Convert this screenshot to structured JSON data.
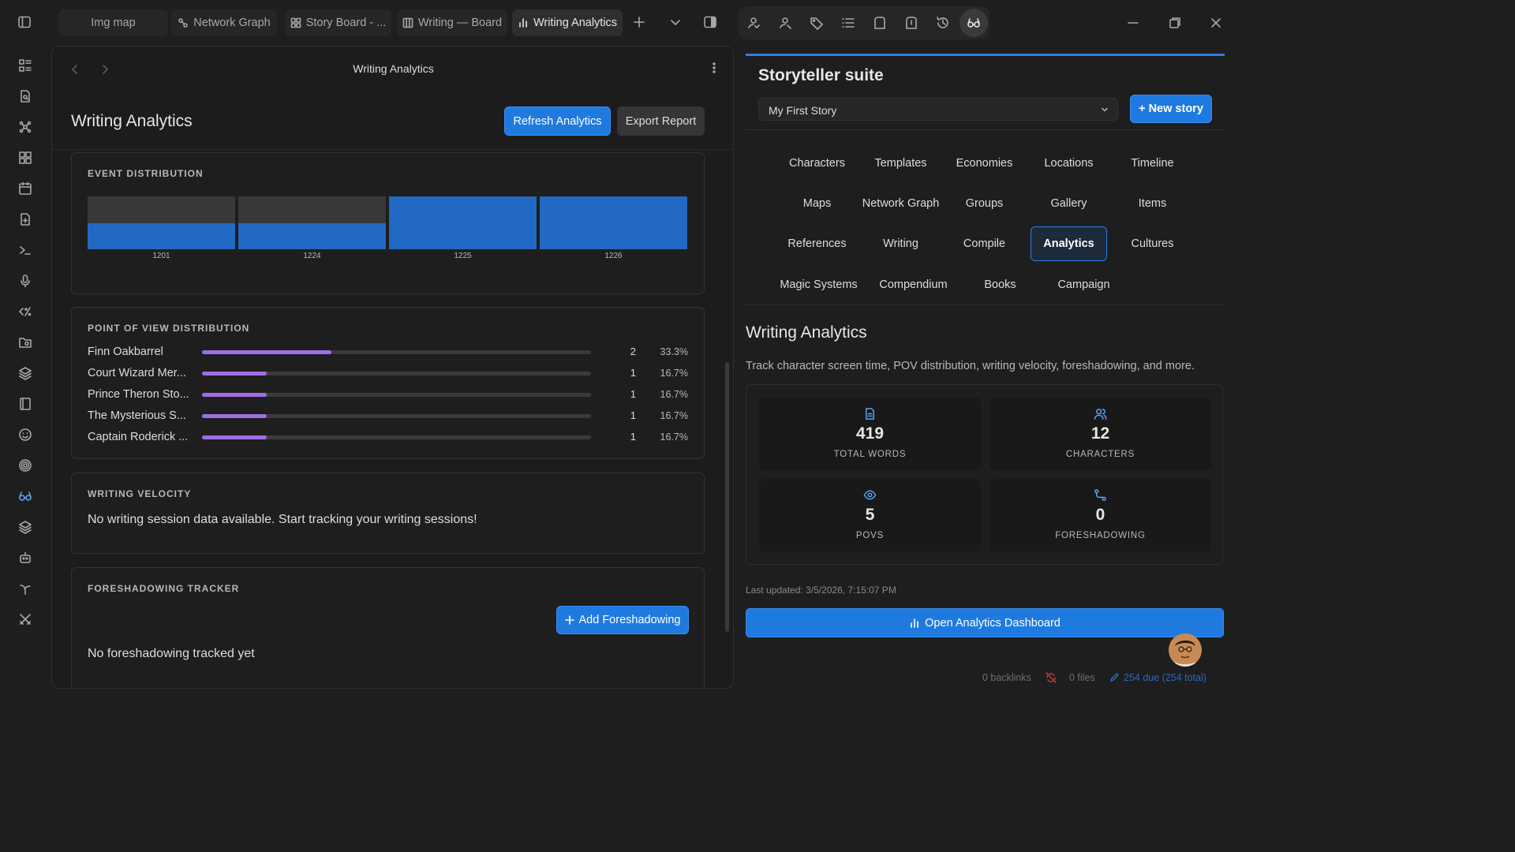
{
  "tabs": [
    {
      "label": "Img map",
      "icon": "none"
    },
    {
      "label": "Network Graph",
      "icon": "graph-icon"
    },
    {
      "label": "Story Board - ...",
      "icon": "board-icon"
    },
    {
      "label": "Writing — Board",
      "icon": "columns-icon"
    },
    {
      "label": "Writing Analytics",
      "icon": "chart-icon",
      "active": true
    }
  ],
  "main": {
    "view_title": "Writing Analytics",
    "heading": "Writing Analytics",
    "refresh_label": "Refresh Analytics",
    "export_label": "Export Report",
    "event_distribution": {
      "title": "EVENT DISTRIBUTION",
      "bars": [
        {
          "label": "1201",
          "value": 0.5
        },
        {
          "label": "1224",
          "value": 0.5
        },
        {
          "label": "1225",
          "value": 1.0
        },
        {
          "label": "1226",
          "value": 1.0
        }
      ]
    },
    "pov": {
      "title": "POINT OF VIEW DISTRIBUTION",
      "rows": [
        {
          "name": "Finn Oakbarrel",
          "count": "2",
          "pct": "33.3%",
          "fraction": 0.333
        },
        {
          "name": "Court Wizard Mer...",
          "count": "1",
          "pct": "16.7%",
          "fraction": 0.167
        },
        {
          "name": "Prince Theron Sto...",
          "count": "1",
          "pct": "16.7%",
          "fraction": 0.167
        },
        {
          "name": "The Mysterious S...",
          "count": "1",
          "pct": "16.7%",
          "fraction": 0.167
        },
        {
          "name": "Captain Roderick ...",
          "count": "1",
          "pct": "16.7%",
          "fraction": 0.167
        }
      ]
    },
    "velocity": {
      "title": "WRITING VELOCITY",
      "empty_text": "No writing session data available. Start tracking your writing sessions!"
    },
    "foreshadowing": {
      "title": "FORESHADOWING TRACKER",
      "add_label": "Add Foreshadowing",
      "empty_text": "No foreshadowing tracked yet"
    }
  },
  "sidebar": {
    "title": "Storyteller suite",
    "story_selected": "My First Story",
    "new_story_label": "+ New story",
    "nav": [
      "Characters",
      "Templates",
      "Economies",
      "Locations",
      "Timeline",
      "Maps",
      "Network Graph",
      "Groups",
      "Gallery",
      "Items",
      "References",
      "Writing",
      "Compile",
      "Analytics",
      "Cultures",
      "Magic Systems",
      "Compendium",
      "Books",
      "Campaign"
    ],
    "active_nav": "Analytics",
    "wa_heading": "Writing Analytics",
    "wa_desc": "Track character screen time, POV distribution, writing velocity, foreshadowing, and more.",
    "stats": [
      {
        "value": "419",
        "label": "TOTAL WORDS",
        "icon": "document-icon"
      },
      {
        "value": "12",
        "label": "CHARACTERS",
        "icon": "users-icon"
      },
      {
        "value": "5",
        "label": "POVS",
        "icon": "eye-icon"
      },
      {
        "value": "0",
        "label": "FORESHADOWING",
        "icon": "route-icon"
      }
    ],
    "last_updated": "Last updated: 3/5/2026, 7:15:07 PM",
    "open_dashboard_label": "Open Analytics Dashboard"
  },
  "status": {
    "backlinks": "0 backlinks",
    "files": "0 files",
    "due": "254 due (254 total)"
  },
  "colors": {
    "accent": "#1f7ae0",
    "bar": "#2269c4",
    "pov": "#a06de8"
  }
}
